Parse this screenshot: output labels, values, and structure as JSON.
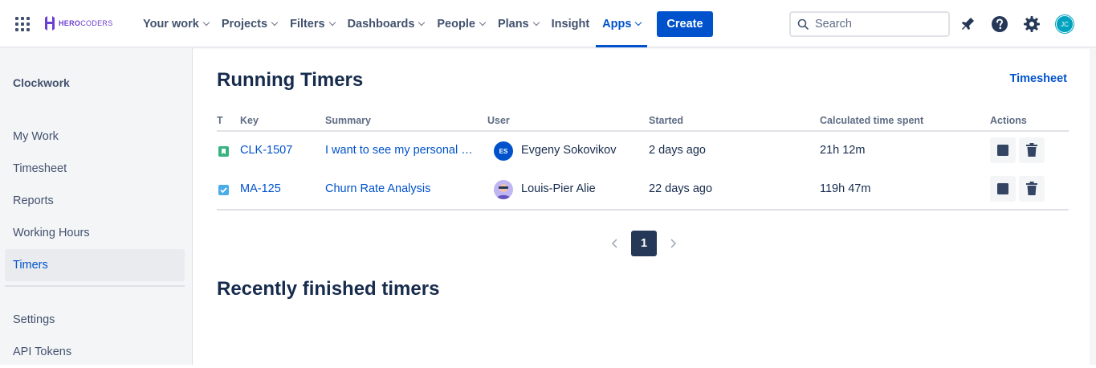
{
  "brand": {
    "name_bold": "HERO",
    "name_light": "CODERS",
    "color": "#6b3fd1"
  },
  "nav": {
    "items": [
      {
        "label": "Your work",
        "dropdown": true
      },
      {
        "label": "Projects",
        "dropdown": true
      },
      {
        "label": "Filters",
        "dropdown": true
      },
      {
        "label": "Dashboards",
        "dropdown": true
      },
      {
        "label": "People",
        "dropdown": true
      },
      {
        "label": "Plans",
        "dropdown": true
      },
      {
        "label": "Insight",
        "dropdown": false
      },
      {
        "label": "Apps",
        "dropdown": true,
        "active": true
      }
    ],
    "create_label": "Create",
    "search_placeholder": "Search",
    "user_initials": "JC"
  },
  "sidebar": {
    "title": "Clockwork",
    "items": [
      {
        "label": "My Work"
      },
      {
        "label": "Timesheet"
      },
      {
        "label": "Reports"
      },
      {
        "label": "Working Hours"
      },
      {
        "label": "Timers",
        "active": true
      },
      {
        "label": "Settings"
      },
      {
        "label": "API Tokens"
      }
    ]
  },
  "main": {
    "title": "Running Timers",
    "timesheet_link": "Timesheet",
    "table": {
      "headers": {
        "type": "T",
        "key": "Key",
        "summary": "Summary",
        "user": "User",
        "started": "Started",
        "time": "Calculated time spent",
        "actions": "Actions"
      },
      "rows": [
        {
          "type_icon": "story-icon",
          "key": "CLK-1507",
          "summary": "I want to see my personal …",
          "user_initials": "ES",
          "user": "Evgeny Sokovikov",
          "started": "2 days ago",
          "time": "21h 12m"
        },
        {
          "type_icon": "task-icon",
          "key": "MA-125",
          "summary": "Churn Rate Analysis",
          "user_initials": "",
          "user": "Louis-Pier Alie",
          "started": "22 days ago",
          "time": "119h 47m"
        }
      ]
    },
    "pagination": {
      "current": "1"
    },
    "section2_title": "Recently finished timers"
  },
  "colors": {
    "accent": "#0052cc",
    "text": "#172b4d",
    "subtle": "#42526e",
    "sidebar_bg": "#f4f5f7"
  }
}
